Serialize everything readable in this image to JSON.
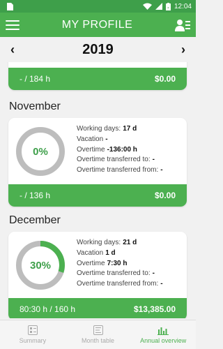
{
  "status_bar": {
    "time": "12:04",
    "battery": "80"
  },
  "app_bar": {
    "title": "MY PROFILE"
  },
  "year_nav": {
    "prev": "‹",
    "year": "2019",
    "next": "›"
  },
  "october": {
    "footer_hours": "- / 184 h",
    "footer_amount": "$0.00"
  },
  "november": {
    "title": "November",
    "percent": "0%",
    "progress": 0,
    "working_days_label": "Working days:",
    "working_days": "17 d",
    "vacation_label": "Vacation",
    "vacation": "-",
    "overtime_label": "Overtime",
    "overtime": "-136:00 h",
    "ot_to_label": "Overtime transferred to:",
    "ot_to": "-",
    "ot_from_label": "Overtime transferred from:",
    "ot_from": "-",
    "footer_hours": "- / 136 h",
    "footer_amount": "$0.00"
  },
  "december": {
    "title": "December",
    "percent": "30%",
    "progress": 0.3,
    "working_days_label": "Working days:",
    "working_days": "21 d",
    "vacation_label": "Vacation",
    "vacation": "1 d",
    "overtime_label": "Overtime",
    "overtime": "7:30 h",
    "ot_to_label": "Overtime transferred to:",
    "ot_to": "-",
    "ot_from_label": "Overtime transferred from:",
    "ot_from": "-",
    "footer_hours": "80:30 h / 160 h",
    "footer_amount": "$13,385.00"
  },
  "bottom_nav": [
    {
      "label": "Summary",
      "icon": "summary-icon",
      "active": false
    },
    {
      "label": "Month table",
      "icon": "month-table-icon",
      "active": false
    },
    {
      "label": "Annual overview",
      "icon": "annual-overview-icon",
      "active": true
    }
  ],
  "colors": {
    "primary": "#4cb050",
    "primary_dark": "#3e9f4a",
    "ring_track": "#bdbdbd"
  }
}
